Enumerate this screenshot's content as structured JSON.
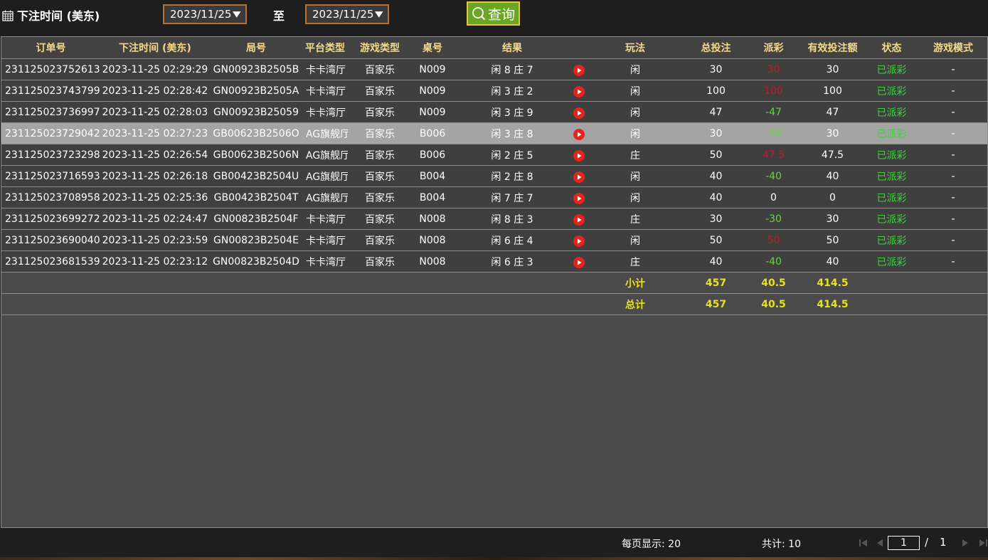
{
  "toolbar": {
    "label": "下注时间 (美东)",
    "date_from": "2023/11/25",
    "date_to": "2023/11/25",
    "sep": "至",
    "query_label": "查询"
  },
  "columns": [
    "订单号",
    "下注时间 (美东)",
    "局号",
    "平台类型",
    "游戏类型",
    "桌号",
    "结果",
    "",
    "玩法",
    "总投注",
    "派彩",
    "有效投注额",
    "状态",
    "游戏模式"
  ],
  "rows": [
    {
      "order": "231125023752613",
      "time": "2023-11-25 02:29:29",
      "round": "GN00923B2505B",
      "platform": "卡卡湾厅",
      "game": "百家乐",
      "table": "N009",
      "result": "闲 8 庄 7",
      "play": "闲",
      "bet": "30",
      "payout": "30",
      "payout_sign": "pos",
      "valid": "30",
      "status": "已派彩",
      "mode": "-"
    },
    {
      "order": "231125023743799",
      "time": "2023-11-25 02:28:42",
      "round": "GN00923B2505A",
      "platform": "卡卡湾厅",
      "game": "百家乐",
      "table": "N009",
      "result": "闲 3 庄 2",
      "play": "闲",
      "bet": "100",
      "payout": "100",
      "payout_sign": "pos",
      "valid": "100",
      "status": "已派彩",
      "mode": "-"
    },
    {
      "order": "231125023736997",
      "time": "2023-11-25 02:28:03",
      "round": "GN00923B25059",
      "platform": "卡卡湾厅",
      "game": "百家乐",
      "table": "N009",
      "result": "闲 3 庄 9",
      "play": "闲",
      "bet": "47",
      "payout": "-47",
      "payout_sign": "neg",
      "valid": "47",
      "status": "已派彩",
      "mode": "-"
    },
    {
      "order": "231125023729042",
      "time": "2023-11-25 02:27:23",
      "round": "GB00623B2506O",
      "platform": "AG旗舰厅",
      "game": "百家乐",
      "table": "B006",
      "result": "闲 3 庄 8",
      "play": "闲",
      "bet": "30",
      "payout": "-30",
      "payout_sign": "neg",
      "valid": "30",
      "status": "已派彩",
      "mode": "-"
    },
    {
      "order": "231125023723298",
      "time": "2023-11-25 02:26:54",
      "round": "GB00623B2506N",
      "platform": "AG旗舰厅",
      "game": "百家乐",
      "table": "B006",
      "result": "闲 2 庄 5",
      "play": "庄",
      "bet": "50",
      "payout": "47.5",
      "payout_sign": "pos",
      "valid": "47.5",
      "status": "已派彩",
      "mode": "-"
    },
    {
      "order": "231125023716593",
      "time": "2023-11-25 02:26:18",
      "round": "GB00423B2504U",
      "platform": "AG旗舰厅",
      "game": "百家乐",
      "table": "B004",
      "result": "闲 2 庄 8",
      "play": "闲",
      "bet": "40",
      "payout": "-40",
      "payout_sign": "neg",
      "valid": "40",
      "status": "已派彩",
      "mode": "-"
    },
    {
      "order": "231125023708958",
      "time": "2023-11-25 02:25:36",
      "round": "GB00423B2504T",
      "platform": "AG旗舰厅",
      "game": "百家乐",
      "table": "B004",
      "result": "闲 7 庄 7",
      "play": "闲",
      "bet": "40",
      "payout": "0",
      "payout_sign": "zero",
      "valid": "0",
      "status": "已派彩",
      "mode": "-"
    },
    {
      "order": "231125023699272",
      "time": "2023-11-25 02:24:47",
      "round": "GN00823B2504F",
      "platform": "卡卡湾厅",
      "game": "百家乐",
      "table": "N008",
      "result": "闲 8 庄 3",
      "play": "庄",
      "bet": "30",
      "payout": "-30",
      "payout_sign": "neg",
      "valid": "30",
      "status": "已派彩",
      "mode": "-"
    },
    {
      "order": "231125023690040",
      "time": "2023-11-25 02:23:59",
      "round": "GN00823B2504E",
      "platform": "卡卡湾厅",
      "game": "百家乐",
      "table": "N008",
      "result": "闲 6 庄 4",
      "play": "闲",
      "bet": "50",
      "payout": "50",
      "payout_sign": "pos",
      "valid": "50",
      "status": "已派彩",
      "mode": "-"
    },
    {
      "order": "231125023681539",
      "time": "2023-11-25 02:23:12",
      "round": "GN00823B2504D",
      "platform": "卡卡湾厅",
      "game": "百家乐",
      "table": "N008",
      "result": "闲 6 庄 3",
      "play": "庄",
      "bet": "40",
      "payout": "-40",
      "payout_sign": "neg",
      "valid": "40",
      "status": "已派彩",
      "mode": "-"
    }
  ],
  "highlight_row": 3,
  "summary": [
    {
      "label": "小计",
      "bet": "457",
      "payout": "40.5",
      "valid": "414.5"
    },
    {
      "label": "总计",
      "bet": "457",
      "payout": "40.5",
      "valid": "414.5"
    }
  ],
  "footer": {
    "per_page": "每页显示: 20",
    "total": "共计: 10",
    "current_page": "1",
    "slash": "/",
    "page_count": "1"
  },
  "colors": {
    "header_text": "#f5d98a",
    "positive_payout": "#c0192b",
    "negative_payout": "#66d43a",
    "status_text": "#3ad43a",
    "summary_text": "#e9e11c",
    "query_button": "#6aa523"
  },
  "icons": {
    "calendar": "calendar-icon",
    "search": "search-icon",
    "dropdown": "dropdown-arrow-icon",
    "play": "play-video-icon",
    "pager_first": "first-page-icon",
    "pager_prev": "prev-page-icon",
    "pager_next": "next-page-icon",
    "pager_last": "last-page-icon"
  }
}
